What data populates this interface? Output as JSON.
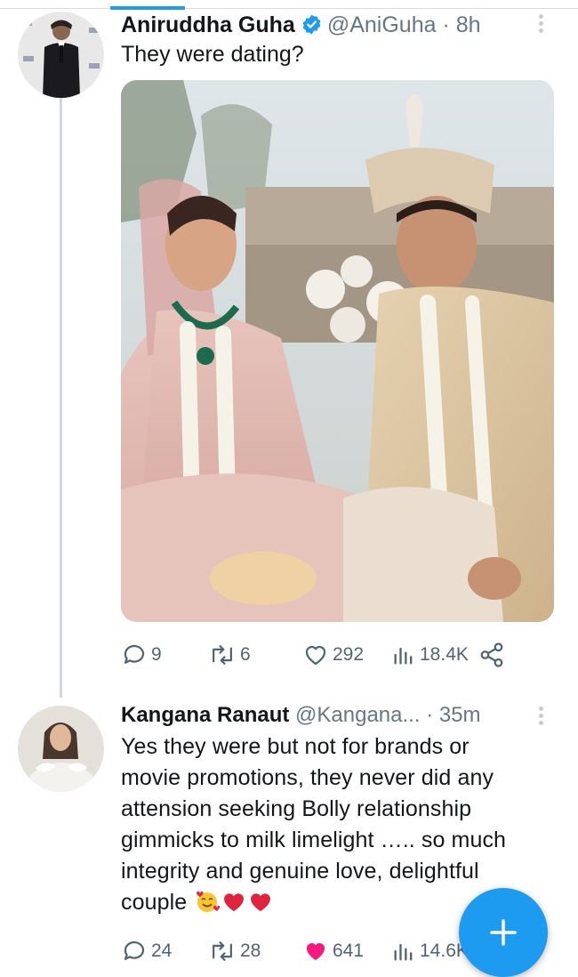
{
  "tweets": [
    {
      "name": "Aniruddha Guha",
      "handle": "@AniGuha",
      "time": "· 8h",
      "text": "They were dating?",
      "stats": {
        "replies": "9",
        "retweets": "6",
        "likes": "292",
        "views": "18.4K"
      }
    },
    {
      "name": "Kangana Ranaut",
      "handle": "@Kangana...",
      "time": "· 35m",
      "lines": [
        "Yes they were but not for brands or",
        "movie promotions, they never did any",
        "attension seeking Bolly relationship",
        "gimmicks to milk limelight ….. so much",
        "integrity and genuine love, delightful",
        "couple"
      ],
      "stats": {
        "replies": "24",
        "retweets": "28",
        "likes": "641",
        "views": "14.6K"
      }
    }
  ],
  "colors": {
    "accent": "#1d9bf0",
    "like": "#f91880",
    "muted": "#536471"
  },
  "icons": [
    "reply-icon",
    "retweet-icon",
    "like-icon",
    "views-icon",
    "share-icon",
    "verified-icon",
    "compose-plus-icon"
  ]
}
